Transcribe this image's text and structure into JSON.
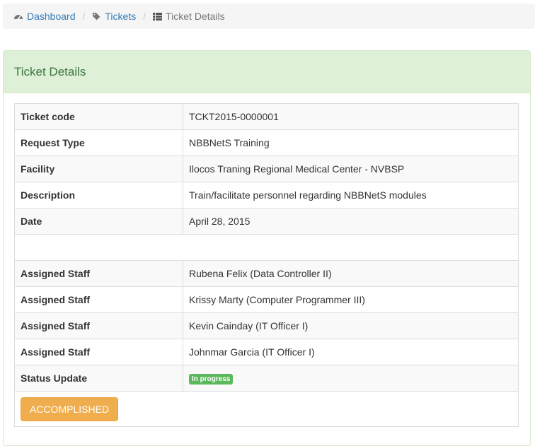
{
  "breadcrumb": {
    "dashboard": "Dashboard",
    "tickets": "Tickets",
    "current": "Ticket Details",
    "separator": "/"
  },
  "panel": {
    "title": "Ticket Details"
  },
  "details": [
    {
      "label": "Ticket code",
      "value": "TCKT2015-0000001"
    },
    {
      "label": "Request Type",
      "value": "NBBNetS Training"
    },
    {
      "label": "Facility",
      "value": "Ilocos Traning Regional Medical Center - NVBSP"
    },
    {
      "label": "Description",
      "value": "Train/facilitate personnel regarding NBBNetS modules"
    },
    {
      "label": "Date",
      "value": "April 28, 2015"
    }
  ],
  "staff": [
    {
      "label": "Assigned Staff",
      "value": "Rubena Felix (Data Controller II)"
    },
    {
      "label": "Assigned Staff",
      "value": "Krissy Marty (Computer Programmer III)"
    },
    {
      "label": "Assigned Staff",
      "value": "Kevin Cainday (IT Officer I)"
    },
    {
      "label": "Assigned Staff",
      "value": "Johnmar Garcia (IT Officer I)"
    }
  ],
  "status": {
    "label": "Status Update",
    "badge": "In progress",
    "badge_color": "#5cb85c"
  },
  "actions": {
    "accomplished_label": "ACCOMPLISHED",
    "accomplished_color": "#f0ad4e"
  },
  "icons": {
    "dashboard": "dashboard-icon",
    "tickets": "tag-icon",
    "details": "list-icon"
  }
}
